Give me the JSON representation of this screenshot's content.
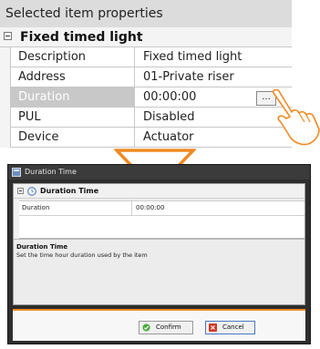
{
  "panel": {
    "header": "Selected item properties",
    "group_title": "Fixed timed light",
    "rows": [
      {
        "key": "Description",
        "value": "Fixed timed light"
      },
      {
        "key": "Address",
        "value": "01-Private riser"
      },
      {
        "key": "Duration",
        "value": "00:00:00"
      },
      {
        "key": "PUL",
        "value": "Disabled"
      },
      {
        "key": "Device",
        "value": "Actuator"
      }
    ],
    "ellipsis_label": "..."
  },
  "dialog": {
    "title": "Duration Time",
    "group_title": "Duration Time",
    "row": {
      "key": "Duration",
      "value": "00:00:00"
    },
    "description_heading": "Duration Time",
    "description_text": "Set the time hour duration used by the item",
    "confirm_label": "Confirm",
    "cancel_label": "Cancel"
  },
  "colors": {
    "accent": "#f08a24",
    "selected_row": "#c8c8c8",
    "dialog_frame": "#2e2e2e"
  },
  "icons": [
    "collapse-icon",
    "hand-cursor-icon",
    "down-arrow-icon",
    "app-window-icon",
    "clock-icon",
    "check-icon",
    "x-icon"
  ]
}
